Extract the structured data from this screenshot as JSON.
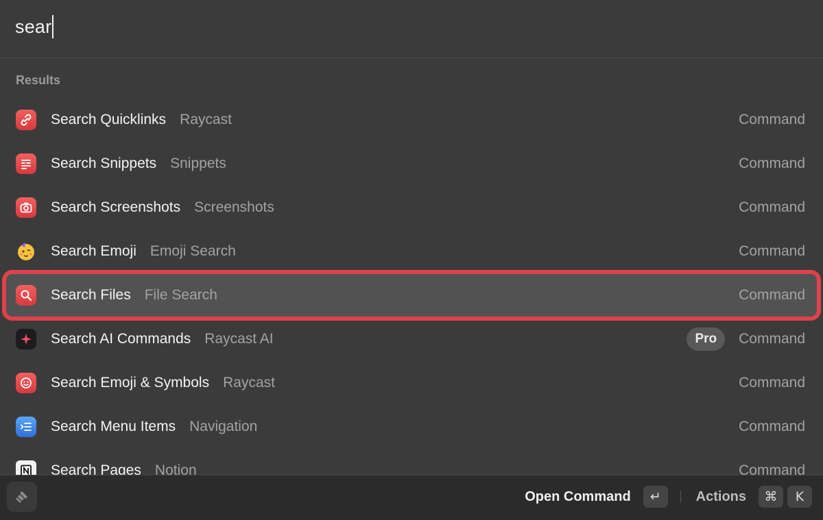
{
  "search": {
    "query": "sear"
  },
  "section": {
    "title": "Results"
  },
  "results": [
    {
      "title": "Search Quicklinks",
      "subtitle": "Raycast",
      "kind": "Command",
      "icon": "link-icon"
    },
    {
      "title": "Search Snippets",
      "subtitle": "Snippets",
      "kind": "Command",
      "icon": "snippets-icon"
    },
    {
      "title": "Search Screenshots",
      "subtitle": "Screenshots",
      "kind": "Command",
      "icon": "camera-icon"
    },
    {
      "title": "Search Emoji",
      "subtitle": "Emoji Search",
      "kind": "Command",
      "icon": "party-emoji-icon"
    },
    {
      "title": "Search Files",
      "subtitle": "File Search",
      "kind": "Command",
      "icon": "magnifier-icon",
      "selected": true
    },
    {
      "title": "Search AI Commands",
      "subtitle": "Raycast AI",
      "kind": "Command",
      "badge": "Pro",
      "icon": "sparkle-icon"
    },
    {
      "title": "Search Emoji & Symbols",
      "subtitle": "Raycast",
      "kind": "Command",
      "icon": "smiley-icon"
    },
    {
      "title": "Search Menu Items",
      "subtitle": "Navigation",
      "kind": "Command",
      "icon": "menu-list-icon"
    },
    {
      "title": "Search Pages",
      "subtitle": "Notion",
      "kind": "Command",
      "icon": "notion-icon"
    }
  ],
  "footer": {
    "primary_action": "Open Command",
    "primary_key": "↵",
    "secondary_action": "Actions",
    "secondary_keys": [
      "⌘",
      "K"
    ]
  },
  "colors": {
    "background": "#3b3b3c",
    "selection_outline": "#e0414a",
    "selected_row": "#525253"
  }
}
